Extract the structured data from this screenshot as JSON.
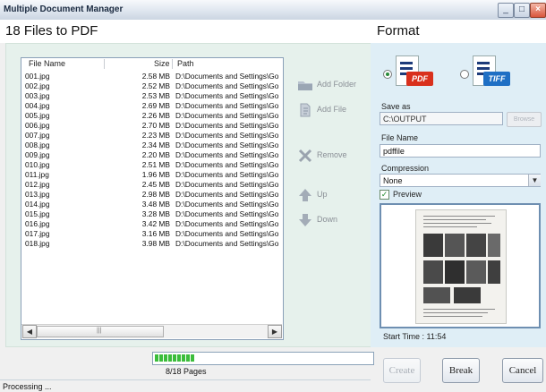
{
  "window": {
    "title": "Multiple Document Manager"
  },
  "left_title": "18 Files to PDF",
  "file_list": {
    "columns": [
      "File Name",
      "Size",
      "Path"
    ],
    "rows": [
      {
        "name": "001.jpg",
        "size": "2.58 MB",
        "path": "D:\\Documents and Settings\\Go"
      },
      {
        "name": "002.jpg",
        "size": "2.52 MB",
        "path": "D:\\Documents and Settings\\Go"
      },
      {
        "name": "003.jpg",
        "size": "2.53 MB",
        "path": "D:\\Documents and Settings\\Go"
      },
      {
        "name": "004.jpg",
        "size": "2.69 MB",
        "path": "D:\\Documents and Settings\\Go"
      },
      {
        "name": "005.jpg",
        "size": "2.26 MB",
        "path": "D:\\Documents and Settings\\Go"
      },
      {
        "name": "006.jpg",
        "size": "2.70 MB",
        "path": "D:\\Documents and Settings\\Go"
      },
      {
        "name": "007.jpg",
        "size": "2.23 MB",
        "path": "D:\\Documents and Settings\\Go"
      },
      {
        "name": "008.jpg",
        "size": "2.34 MB",
        "path": "D:\\Documents and Settings\\Go"
      },
      {
        "name": "009.jpg",
        "size": "2.20 MB",
        "path": "D:\\Documents and Settings\\Go"
      },
      {
        "name": "010.jpg",
        "size": "2.51 MB",
        "path": "D:\\Documents and Settings\\Go"
      },
      {
        "name": "011.jpg",
        "size": "1.96 MB",
        "path": "D:\\Documents and Settings\\Go"
      },
      {
        "name": "012.jpg",
        "size": "2.45 MB",
        "path": "D:\\Documents and Settings\\Go"
      },
      {
        "name": "013.jpg",
        "size": "2.98 MB",
        "path": "D:\\Documents and Settings\\Go"
      },
      {
        "name": "014.jpg",
        "size": "3.48 MB",
        "path": "D:\\Documents and Settings\\Go"
      },
      {
        "name": "015.jpg",
        "size": "3.28 MB",
        "path": "D:\\Documents and Settings\\Go"
      },
      {
        "name": "016.jpg",
        "size": "3.42 MB",
        "path": "D:\\Documents and Settings\\Go"
      },
      {
        "name": "017.jpg",
        "size": "3.16 MB",
        "path": "D:\\Documents and Settings\\Go"
      },
      {
        "name": "018.jpg",
        "size": "3.98 MB",
        "path": "D:\\Documents and Settings\\Go"
      }
    ]
  },
  "list_actions": {
    "add_folder": "Add Folder",
    "add_file": "Add File",
    "remove": "Remove",
    "up": "Up",
    "down": "Down"
  },
  "format": {
    "title": "Format",
    "options": [
      {
        "label": "PDF",
        "selected": true,
        "color": "#d9301c"
      },
      {
        "label": "TIFF",
        "selected": false,
        "color": "#1f6fc4"
      }
    ],
    "save_as_label": "Save as",
    "save_as_value": "C:\\OUTPUT",
    "browse_label": "Browse",
    "file_name_label": "File Name",
    "file_name_value": "pdffile",
    "compression_label": "Compression",
    "compression_value": "None",
    "preview_label": "Preview",
    "preview_checked": true,
    "start_time": "Start Time  : 11:54"
  },
  "progress": {
    "text": "8/18 Pages",
    "fraction": 0.44,
    "color": "#3bbd3b"
  },
  "buttons": {
    "create": "Create",
    "break": "Break",
    "cancel": "Cancel"
  },
  "status": "Processing ..."
}
